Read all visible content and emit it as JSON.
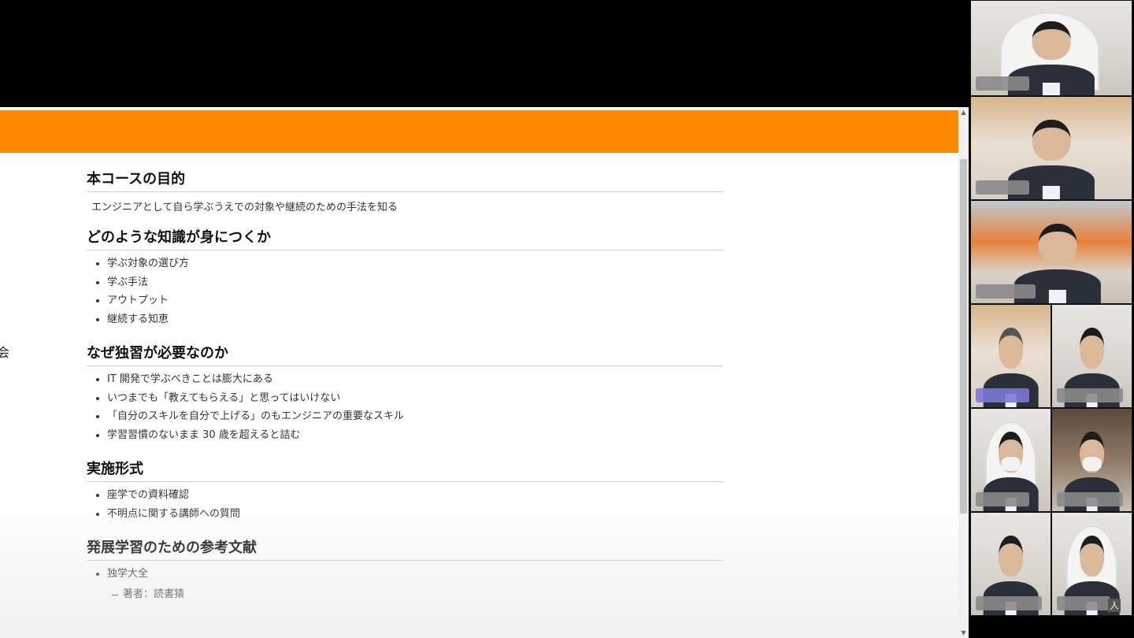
{
  "document": {
    "sections": [
      {
        "heading": "本コースの目的",
        "text": "エンジニアとして自ら学ぶうえでの対象や継続のための手法を知る"
      },
      {
        "heading": "どのような知識が身につくか",
        "items": [
          "学ぶ対象の選び方",
          "学ぶ手法",
          "アウトプット",
          "継続する知恵"
        ]
      },
      {
        "heading": "なぜ独習が必要なのか",
        "items": [
          "IT 開発で学ぶべきことは膨大にある",
          "いつまでも「教えてもらえる」と思ってはいけない",
          "「自分のスキルを自分で上げる」のもエンジニアの重要なスキル",
          "学習習慣のないまま 30 歳を超えると詰む"
        ]
      },
      {
        "heading": "実施形式",
        "items": [
          "座学での資料確認",
          "不明点に関する講師への質問"
        ]
      },
      {
        "heading": "発展学習のための参考文献",
        "items": [
          "独学大全"
        ],
        "sub_items": [
          "著者：読書猿"
        ]
      }
    ],
    "edge_glyph": "会"
  },
  "gallery": {
    "last_tile_label": "人"
  },
  "colors": {
    "banner": "#ff8a00",
    "background": "#000000",
    "highlight_tag": "#7b78d8"
  }
}
